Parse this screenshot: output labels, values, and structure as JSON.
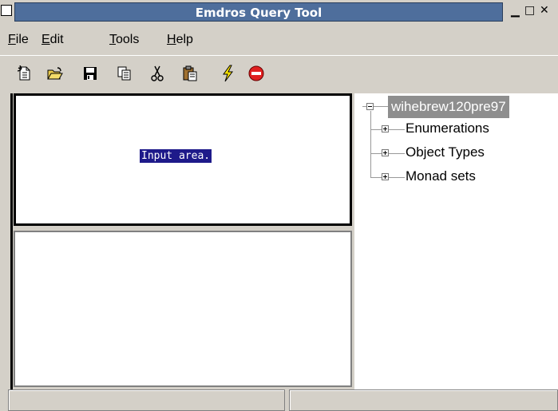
{
  "window": {
    "title": "Emdros Query Tool"
  },
  "menu": [
    "File",
    "Edit",
    "Tools",
    "Help"
  ],
  "toolbar": {
    "icons": [
      "new-file-icon",
      "open-folder-icon",
      "save-disk-icon",
      "copy-icon",
      "cut-scissors-icon",
      "paste-clipboard-icon",
      "execute-lightning-icon",
      "stop-icon"
    ]
  },
  "input_area": {
    "selected_text": "Input area."
  },
  "tree": {
    "root": "wihebrew120pre97",
    "children": [
      "Enumerations",
      "Object Types",
      "Monad sets"
    ]
  },
  "colors": {
    "titlebar": "#4e6e9c",
    "selection": "#1e1a8a",
    "root_highlight": "#8e8e8e"
  }
}
